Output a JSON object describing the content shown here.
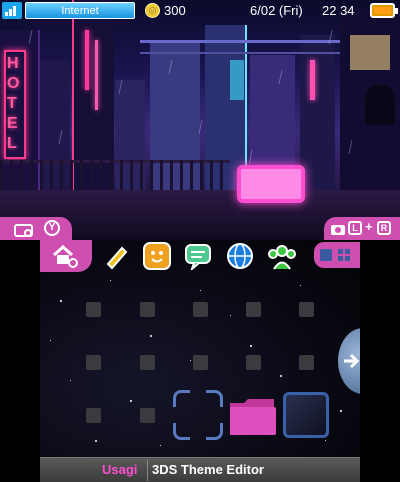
{
  "status": {
    "internet_label": "Internet",
    "coins": "300",
    "date": "6/02 (Fri)",
    "time": "22 34"
  },
  "colors": {
    "accent": "#cf4fb0",
    "wifi": "#1aa4ea",
    "battery": "#ff9d16",
    "author": "#ff4fd0"
  },
  "icons": {
    "wifi": "wifi-signal-icon",
    "coin": "play-coin-icon",
    "battery": "battery-icon",
    "camera": "camera-icon",
    "y_button": "y-button-icon",
    "screenshot": "camera-icon",
    "l_button": "l-button-icon",
    "r_button": "r-button-icon",
    "settings": "home-settings-icon",
    "list_view": "list-view-icon",
    "grid_view": "grid-view-icon"
  },
  "shoulder_buttons": {
    "y_label": "Y",
    "l_label": "L",
    "r_label": "R",
    "plus": "+"
  },
  "apps": [
    {
      "name": "notes",
      "icon": "pencil-icon",
      "color": "#f4c21c"
    },
    {
      "name": "friends",
      "icon": "smile-face-icon",
      "color": "#f0a020"
    },
    {
      "name": "notifications",
      "icon": "speech-bubble-icon",
      "color": "#4cc890"
    },
    {
      "name": "browser",
      "icon": "globe-icon",
      "color": "#1a7ee0"
    },
    {
      "name": "miiverse",
      "icon": "people-icon",
      "color": "#3cc840"
    }
  ],
  "theme": {
    "author": "Usagi",
    "title": "3DS Theme Editor"
  },
  "top_signs": {
    "hotel": "HOTEL"
  }
}
